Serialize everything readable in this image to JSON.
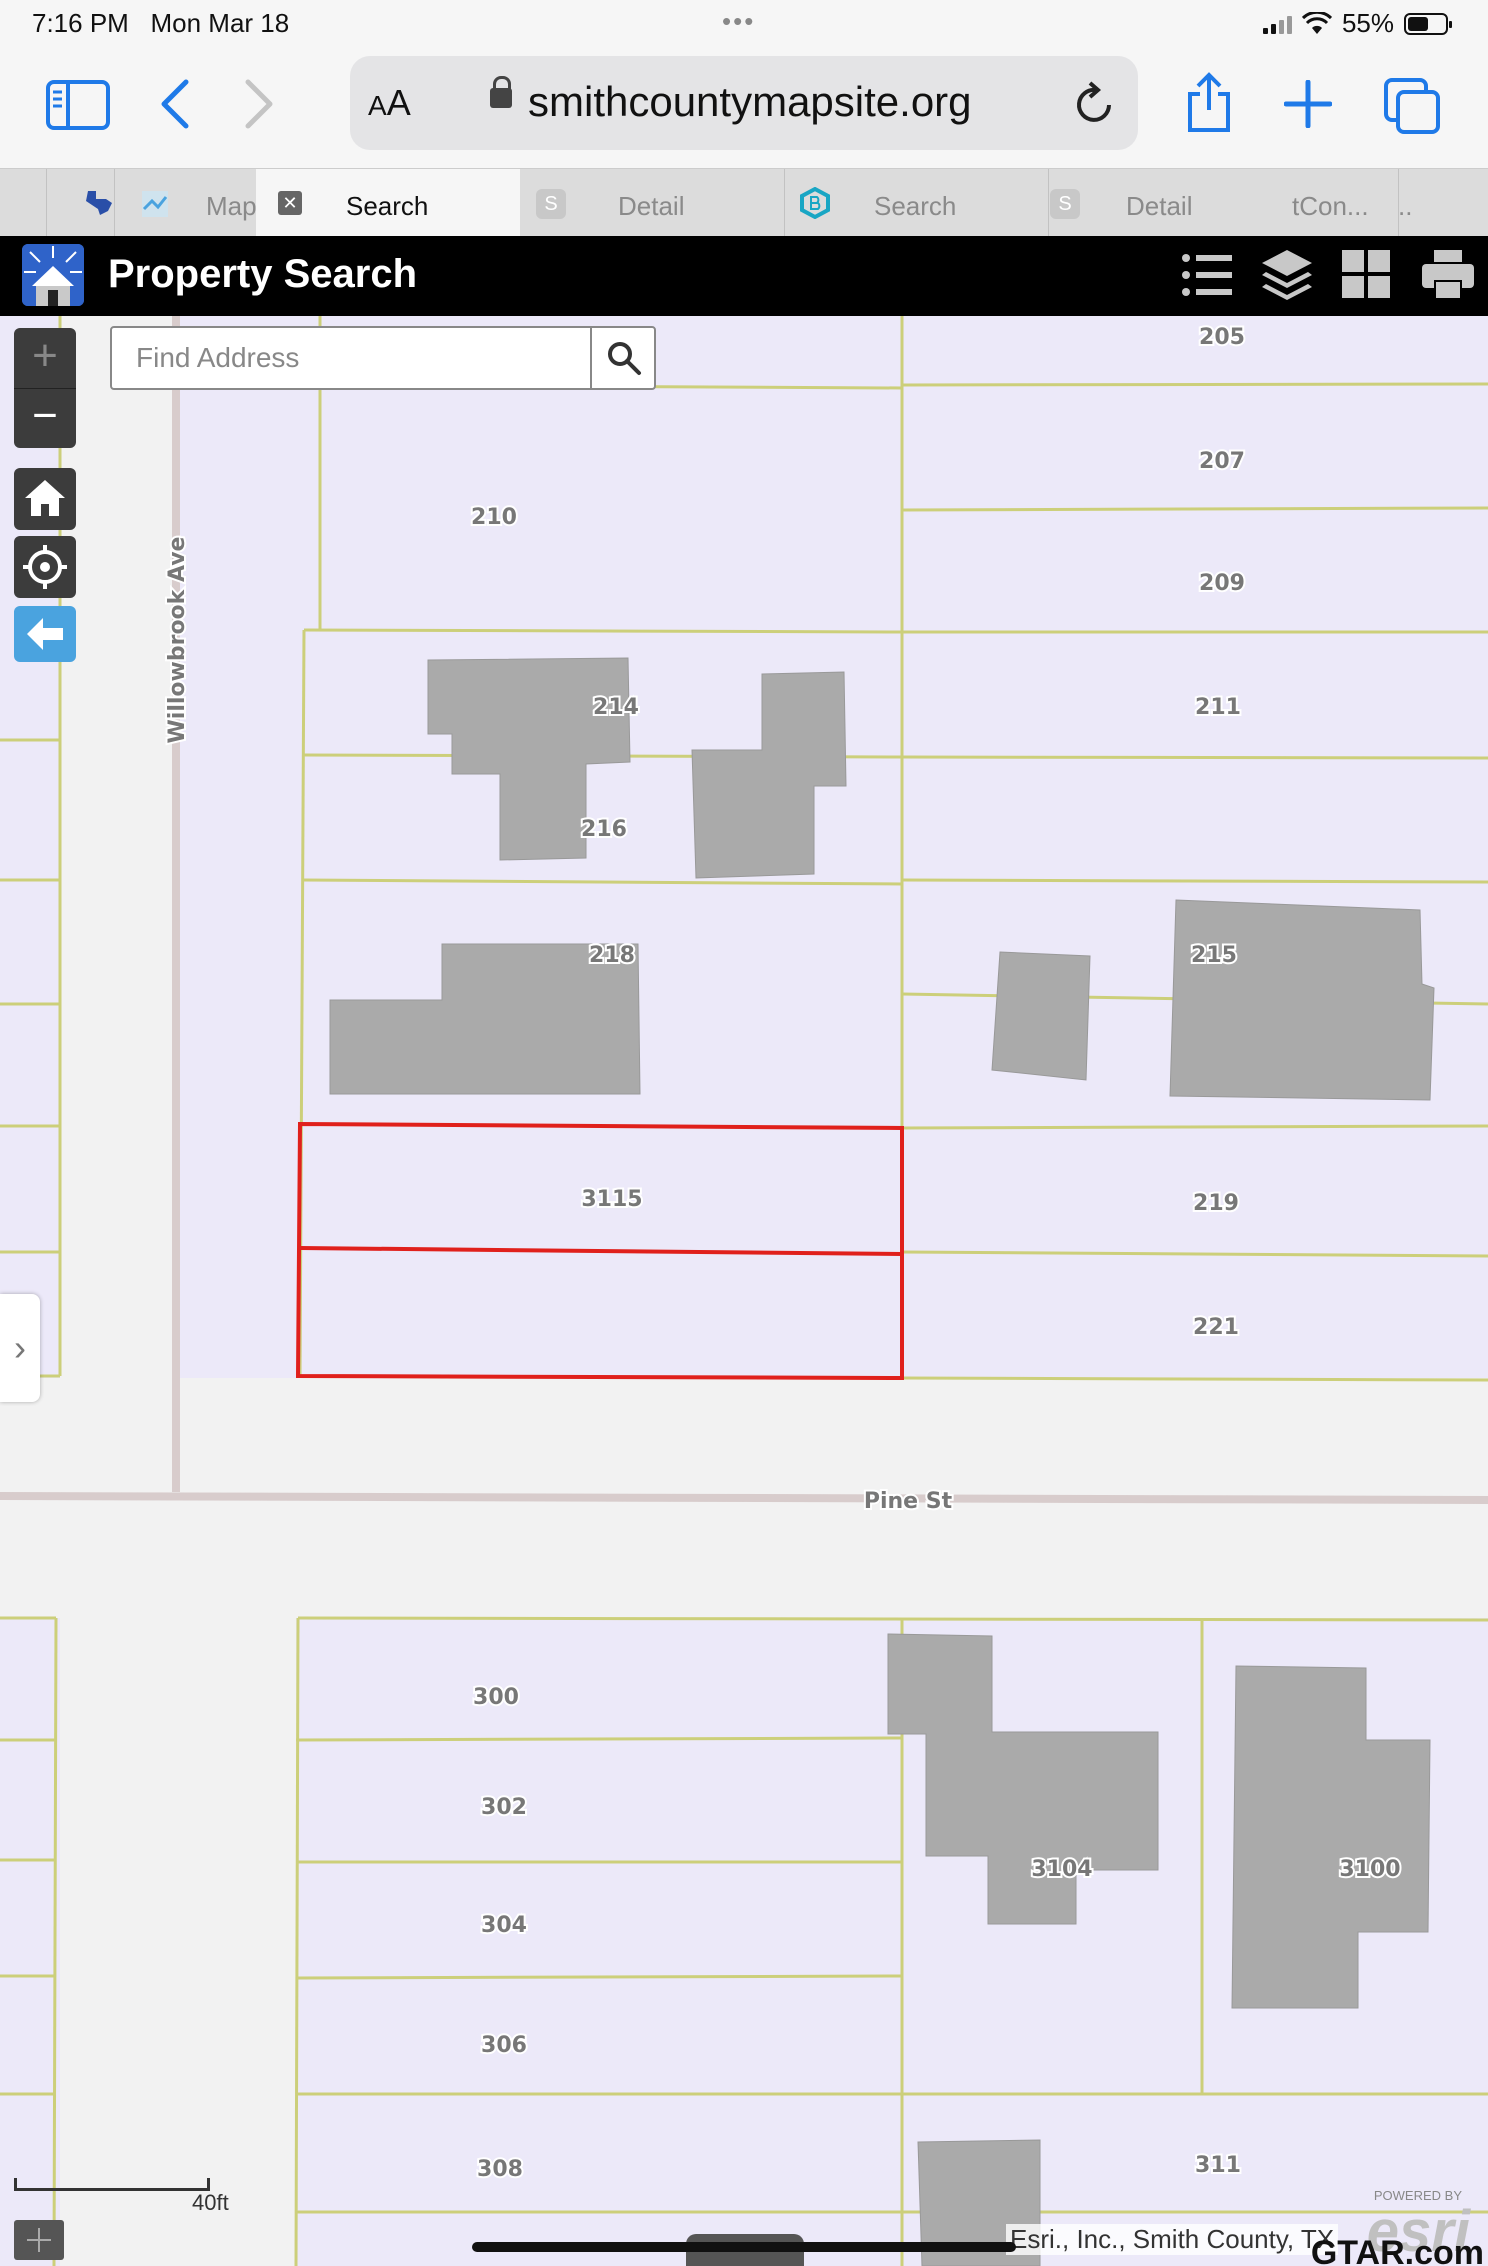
{
  "status_bar": {
    "time": "7:16 PM",
    "date": "Mon Mar 18",
    "battery": "55%",
    "battery_level": 0.55,
    "dots": "•••"
  },
  "browser": {
    "text_size_label": "AA",
    "url": "smithcountymapsite.org",
    "icons": [
      "sidebar-icon",
      "back-icon",
      "forward-icon",
      "lock-icon",
      "reload-icon",
      "share-icon",
      "add-icon",
      "tabs-icon"
    ]
  },
  "tabs": [
    {
      "label": "Map",
      "active": false
    },
    {
      "label": "Search",
      "active": true
    },
    {
      "label": "Detail",
      "active": false
    },
    {
      "label": "Search",
      "active": false
    },
    {
      "label": "Detail",
      "active": false
    },
    {
      "label": "tCon...",
      "active": false
    },
    {
      "label": "..",
      "active": false
    }
  ],
  "app": {
    "title": "Property Search",
    "header_icons": [
      "list-icon",
      "layers-icon",
      "grid-icon",
      "print-icon"
    ]
  },
  "search": {
    "placeholder": "Find Address"
  },
  "map_controls": {
    "zoom_in": "+",
    "zoom_out": "−"
  },
  "streets": {
    "vertical": "Willowbrook Ave",
    "horizontal": "Pine St"
  },
  "parcel_labels": [
    "205",
    "207",
    "210",
    "209",
    "214",
    "211",
    "216",
    "218",
    "215",
    "3115",
    "219",
    "221",
    "300",
    "302",
    "304",
    "306",
    "308",
    "3104",
    "3100",
    "311"
  ],
  "selected_parcel": "3115",
  "scale": {
    "label": "40ft"
  },
  "attribution": "Esri., Inc., Smith County, TX",
  "esri_logo": {
    "powered": "POWERED BY",
    "word": "esri"
  },
  "watermark": "GTAR.com",
  "colors": {
    "parcel_fill": "#ece9f9",
    "parcel_line": "#cccf7a",
    "building": "#aaaaaa",
    "selection": "#e0201c",
    "accent": "#1f7ae8"
  }
}
